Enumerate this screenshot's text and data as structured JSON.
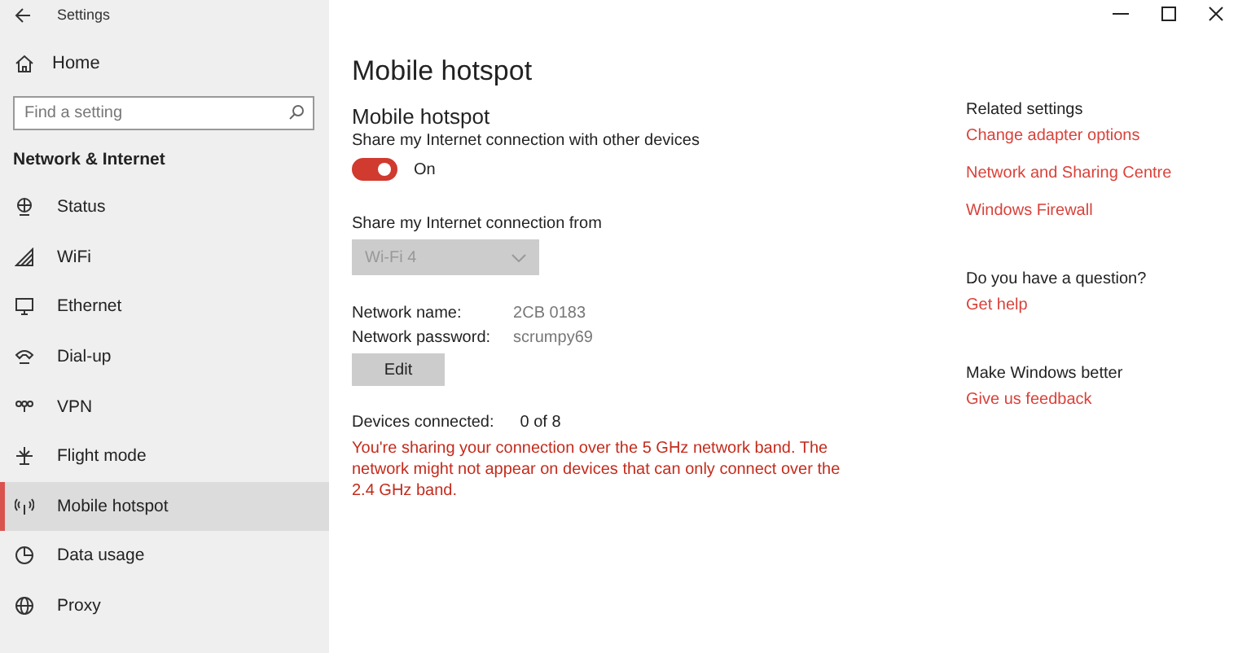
{
  "window": {
    "title": "Settings"
  },
  "sidebar": {
    "home": "Home",
    "search": {
      "placeholder": "Find a setting"
    },
    "section": "Network & Internet",
    "items": [
      {
        "label": "Status",
        "selected": false
      },
      {
        "label": "WiFi",
        "selected": false
      },
      {
        "label": "Ethernet",
        "selected": false
      },
      {
        "label": "Dial-up",
        "selected": false
      },
      {
        "label": "VPN",
        "selected": false
      },
      {
        "label": "Flight mode",
        "selected": false
      },
      {
        "label": "Mobile hotspot",
        "selected": true
      },
      {
        "label": "Data usage",
        "selected": false
      },
      {
        "label": "Proxy",
        "selected": false
      }
    ]
  },
  "page": {
    "title": "Mobile hotspot",
    "heading": "Mobile hotspot",
    "description": "Share my Internet connection with other devices",
    "toggle": {
      "on": true,
      "label": "On"
    },
    "share_from": {
      "label": "Share my Internet connection from",
      "value": "Wi-Fi 4",
      "disabled": true
    },
    "details": [
      {
        "label": "Network name:",
        "value": "2CB 0183"
      },
      {
        "label": "Network password:",
        "value": "scrumpy69"
      }
    ],
    "edit_button": "Edit",
    "devices": {
      "label": "Devices connected:",
      "value": "0 of 8"
    },
    "warning": "You're sharing your connection over the 5 GHz network band. The network might not appear on devices that can only connect over the 2.4 GHz band."
  },
  "related": [
    {
      "heading": "Related settings",
      "links": [
        "Change adapter options",
        "Network and Sharing Centre",
        "Windows Firewall"
      ]
    },
    {
      "heading": "Do you have a question?",
      "links": [
        "Get help"
      ]
    },
    {
      "heading": "Make Windows better",
      "links": [
        "Give us feedback"
      ]
    }
  ]
}
